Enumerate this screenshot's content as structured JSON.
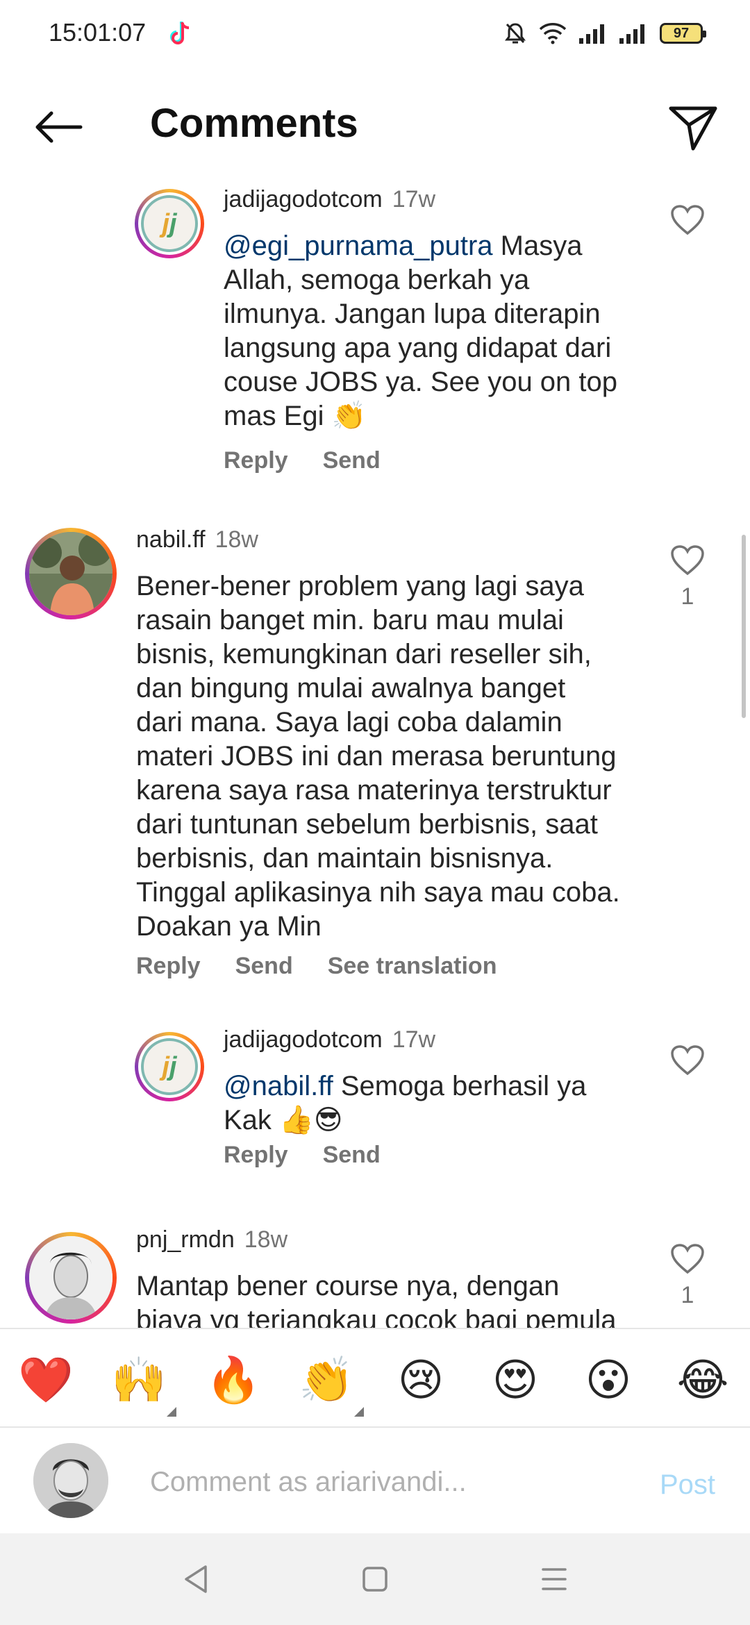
{
  "status_bar": {
    "time": "15:01:07",
    "battery": "97"
  },
  "header": {
    "title": "Comments"
  },
  "comments": [
    {
      "username": "jadijagodotcom",
      "time": "17w",
      "mention": "@egi_purnama_putra",
      "lines": [
        "Masya",
        "Allah, semoga berkah ya",
        "ilmunya. Jangan lupa diterapin",
        "langsung apa yang didapat dari",
        "couse JOBS ya. See you on top",
        "mas Egi 👏"
      ],
      "actions": [
        "Reply",
        "Send"
      ]
    },
    {
      "username": "nabil.ff",
      "time": "18w",
      "lines": [
        "Bener-bener problem yang lagi saya",
        "rasain banget min. baru mau mulai",
        "bisnis, kemungkinan dari reseller sih,",
        "dan bingung mulai awalnya banget",
        "dari mana. Saya lagi coba dalamin",
        "materi JOBS ini dan merasa beruntung",
        "karena saya rasa materinya terstruktur",
        "dari tuntunan sebelum berbisnis, saat",
        "berbisnis, dan maintain bisnisnya.",
        "Tinggal aplikasinya nih saya mau coba.",
        "Doakan ya Min"
      ],
      "actions": [
        "Reply",
        "Send",
        "See translation"
      ],
      "likes": "1"
    },
    {
      "username": "jadijagodotcom",
      "time": "17w",
      "mention": "@nabil.ff",
      "lines": [
        "Semoga berhasil ya",
        "Kak 👍😎"
      ],
      "actions": [
        "Reply",
        "Send"
      ]
    },
    {
      "username": "pnj_rmdn",
      "time": "18w",
      "lines": [
        "Mantap bener course nya, dengan",
        "biaya yg terjangkau cocok bagi pemula"
      ],
      "likes": "1"
    }
  ],
  "emoji_bar": [
    "❤️",
    "🙌",
    "🔥",
    "👏",
    "😢",
    "😍",
    "😮",
    "😂"
  ],
  "input": {
    "placeholder": "Comment as ariarivandi...",
    "post_label": "Post"
  }
}
